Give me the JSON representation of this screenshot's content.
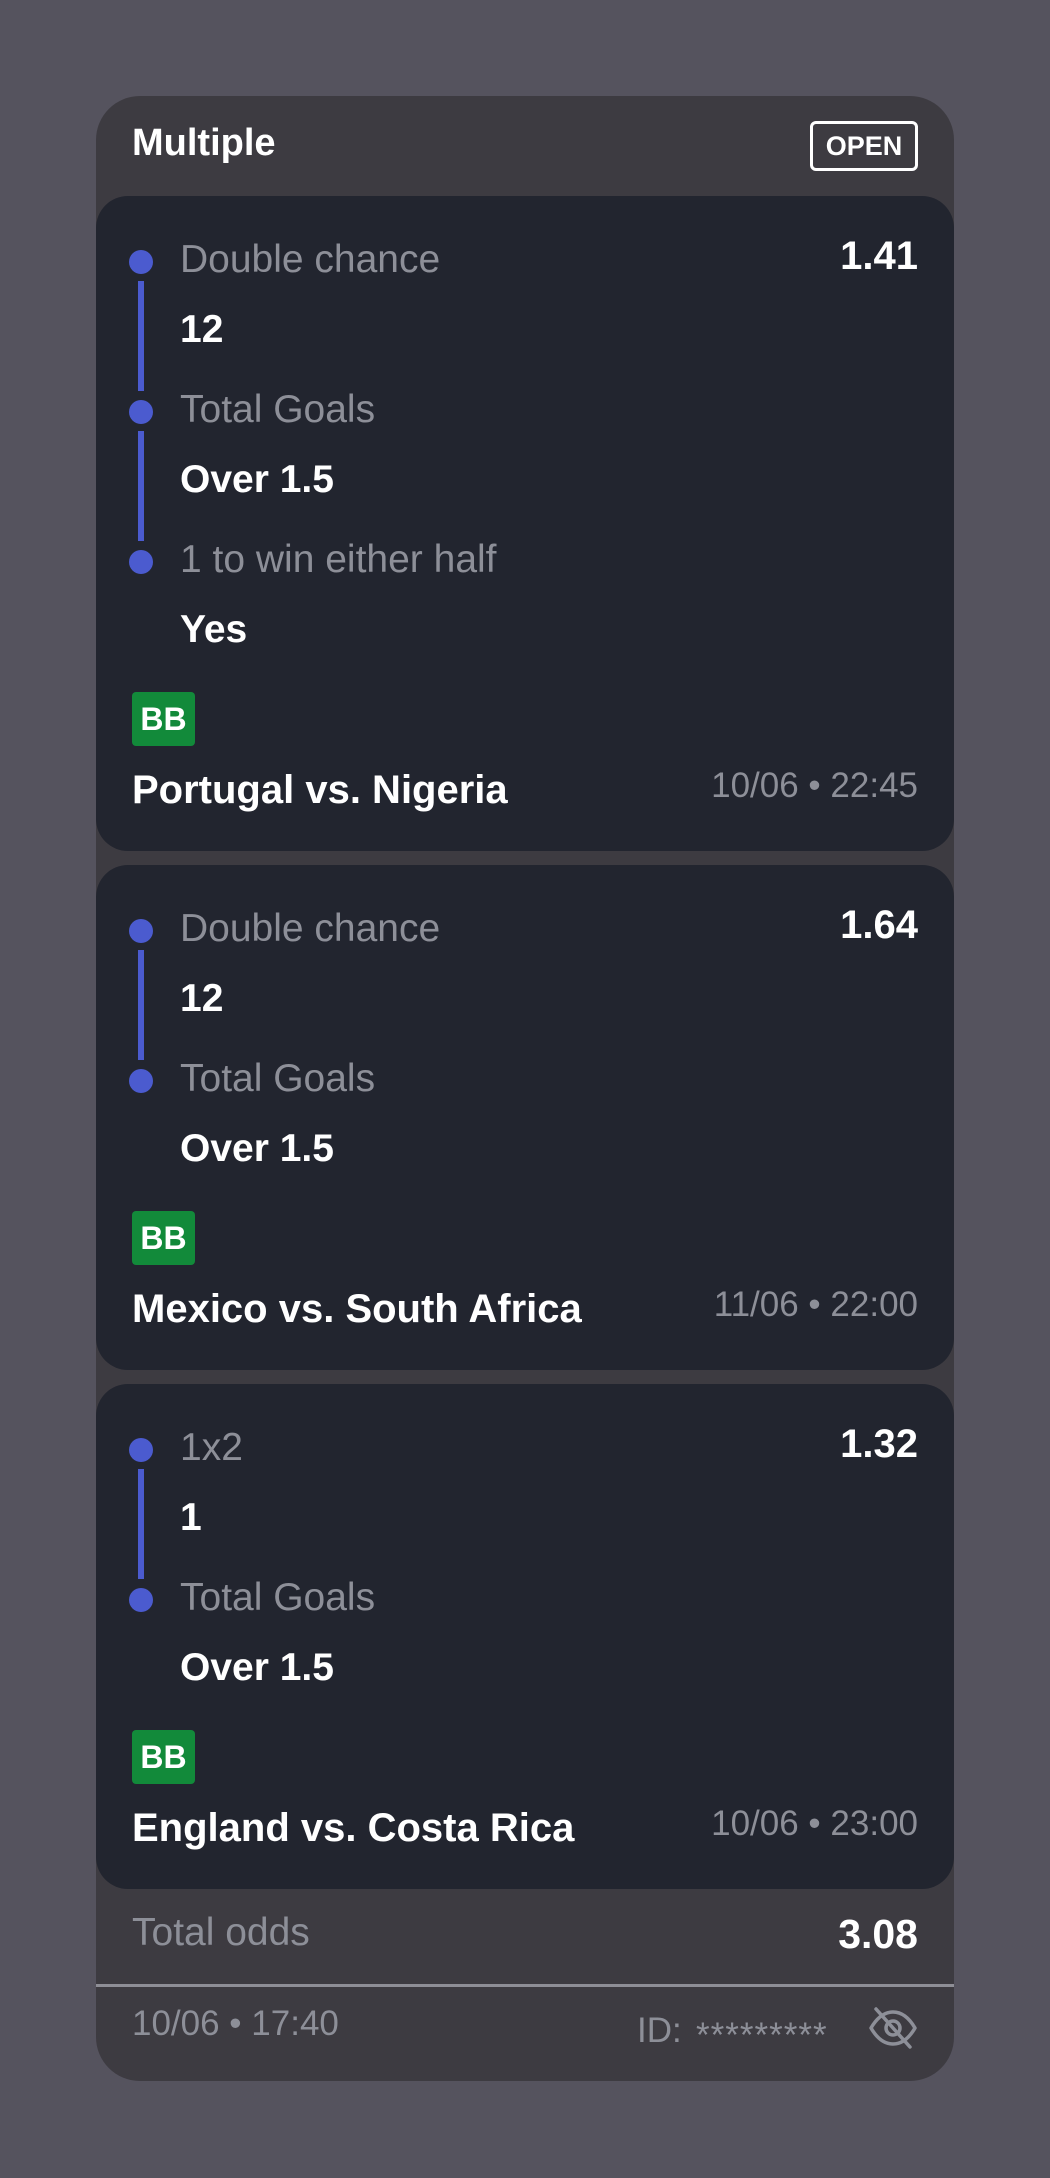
{
  "slip": {
    "title": "Multiple",
    "status": "OPEN"
  },
  "bets": [
    {
      "odds": "1.41",
      "legs": [
        {
          "market": "Double chance",
          "selection": "12"
        },
        {
          "market": "Total Goals",
          "selection": "Over 1.5"
        },
        {
          "market": "1 to win either half",
          "selection": "Yes"
        }
      ],
      "badge": "BB",
      "match": "Portugal vs. Nigeria",
      "time": "10/06 • 22:45"
    },
    {
      "odds": "1.64",
      "legs": [
        {
          "market": "Double chance",
          "selection": "12"
        },
        {
          "market": "Total Goals",
          "selection": "Over 1.5"
        }
      ],
      "badge": "BB",
      "match": "Mexico vs. South Africa",
      "time": "11/06 • 22:00"
    },
    {
      "odds": "1.32",
      "legs": [
        {
          "market": "1x2",
          "selection": "1"
        },
        {
          "market": "Total Goals",
          "selection": "Over 1.5"
        }
      ],
      "badge": "BB",
      "match": "England vs. Costa Rica",
      "time": "10/06 • 23:00"
    }
  ],
  "summary": {
    "total_label": "Total odds",
    "total_value": "3.08",
    "placed_time": "10/06 • 17:40",
    "id_label": "ID:",
    "id_value": "*********",
    "toggle_icon": "eye-off-icon"
  },
  "colors": {
    "background": "#55535e",
    "slip": "#3d3b41",
    "card": "#22252f",
    "leg_accent": "#4b5bcf",
    "bb_badge": "#128a3a",
    "muted_text": "#8d8f98"
  }
}
